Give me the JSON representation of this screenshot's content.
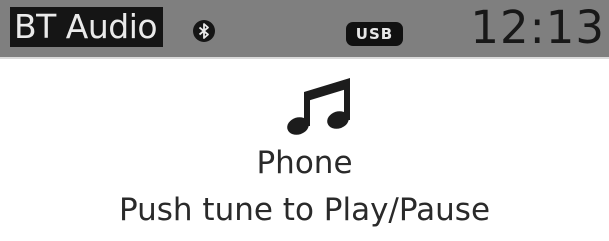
{
  "status_bar": {
    "source": "BT Audio",
    "bluetooth_icon": "bluetooth-icon",
    "usb_badge": "USB",
    "clock": "12:13"
  },
  "main": {
    "media_icon": "music-note-icon",
    "device": "Phone",
    "instruction": "Push tune to Play/Pause"
  },
  "colors": {
    "status_bar_bg": "#7f7f7f",
    "label_bg": "#151515",
    "content_bg": "#ffffff",
    "text": "#2a2a2a"
  }
}
